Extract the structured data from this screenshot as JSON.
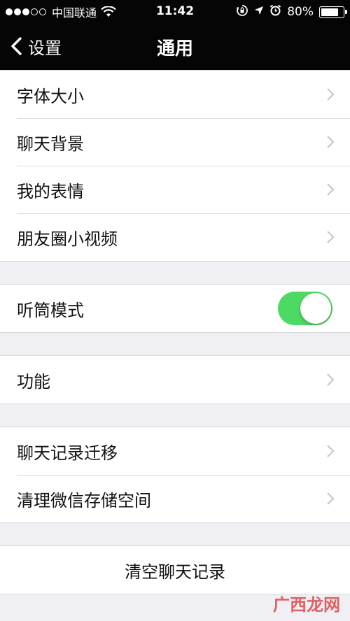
{
  "status_bar": {
    "carrier": "中国联通",
    "time": "11:42",
    "battery": "80%",
    "battery_level": 0.8,
    "signal_dots": [
      true,
      true,
      true,
      false,
      false
    ]
  },
  "nav": {
    "back_label": "设置",
    "title": "通用"
  },
  "groups": [
    {
      "items": [
        {
          "label": "字体大小",
          "accessory": "chevron"
        },
        {
          "label": "聊天背景",
          "accessory": "chevron"
        },
        {
          "label": "我的表情",
          "accessory": "chevron"
        },
        {
          "label": "朋友圈小视频",
          "accessory": "chevron"
        }
      ]
    },
    {
      "items": [
        {
          "label": "听筒模式",
          "accessory": "toggle",
          "on": true
        }
      ]
    },
    {
      "items": [
        {
          "label": "功能",
          "accessory": "chevron"
        }
      ]
    },
    {
      "items": [
        {
          "label": "聊天记录迁移",
          "accessory": "chevron"
        },
        {
          "label": "清理微信存储空间",
          "accessory": "chevron"
        }
      ]
    },
    {
      "items": [
        {
          "label": "清空聊天记录",
          "accessory": "none"
        }
      ]
    }
  ],
  "watermark": "广西龙网",
  "colors": {
    "nav_background": "#050505",
    "page_background": "#efeff4",
    "toggle_on": "#4cd964",
    "chevron": "#c7c7cc"
  }
}
